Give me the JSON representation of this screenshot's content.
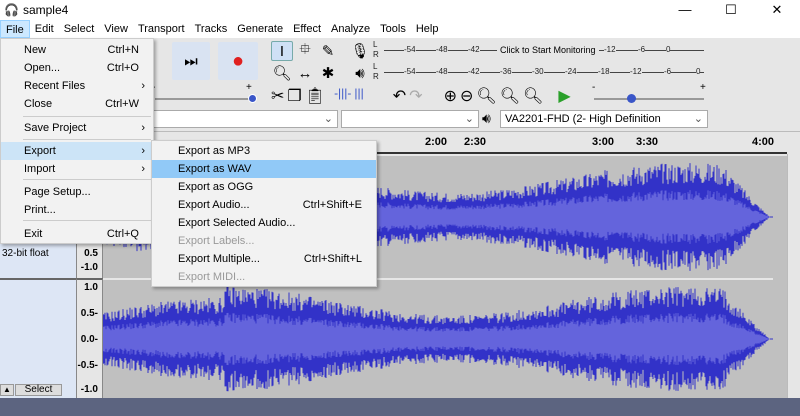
{
  "window": {
    "title": "sample4",
    "minimize": "—",
    "maximize": "☐",
    "close": "✕"
  },
  "menubar": [
    "File",
    "Edit",
    "Select",
    "View",
    "Transport",
    "Tracks",
    "Generate",
    "Effect",
    "Analyze",
    "Tools",
    "Help"
  ],
  "file_menu": [
    {
      "label": "New",
      "shortcut": "Ctrl+N"
    },
    {
      "label": "Open...",
      "shortcut": "Ctrl+O"
    },
    {
      "label": "Recent Files",
      "submenu": true
    },
    {
      "label": "Close",
      "shortcut": "Ctrl+W"
    },
    {
      "label": "Save Project",
      "submenu": true
    },
    {
      "label": "Export",
      "submenu": true,
      "active": true
    },
    {
      "label": "Import",
      "submenu": true
    },
    {
      "label": "Page Setup..."
    },
    {
      "label": "Print..."
    },
    {
      "label": "Exit",
      "shortcut": "Ctrl+Q"
    }
  ],
  "export_menu": [
    {
      "label": "Export as MP3"
    },
    {
      "label": "Export as WAV",
      "highlighted": true
    },
    {
      "label": "Export as OGG"
    },
    {
      "label": "Export Audio...",
      "shortcut": "Ctrl+Shift+E"
    },
    {
      "label": "Export Selected Audio..."
    },
    {
      "label": "Export Labels...",
      "disabled": true
    },
    {
      "label": "Export Multiple...",
      "shortcut": "Ctrl+Shift+L"
    },
    {
      "label": "Export MIDI...",
      "disabled": true
    }
  ],
  "meters": {
    "record_ticks": [
      "-54",
      "-48",
      "-42",
      "-18",
      "-12",
      "-6",
      "0"
    ],
    "record_prompt": "Click to Start Monitoring",
    "play_ticks": [
      "-54",
      "-48",
      "-42",
      "-36",
      "-30",
      "-24",
      "-18",
      "-12",
      "-6",
      "0"
    ],
    "channels": [
      "L",
      "R"
    ]
  },
  "slider": {
    "minus": "-",
    "plus": "+"
  },
  "device": {
    "output": "VA2201-FHD (2- High Definition"
  },
  "ruler": [
    "2:00",
    "2:30",
    "3:00",
    "3:30",
    "4:00"
  ],
  "track": {
    "format": "32-bit float",
    "select": "Select",
    "scale_top": [
      "0.5",
      "-1.0"
    ],
    "scale": [
      "1.0",
      "0.5-",
      "0.0-",
      "-0.5-",
      "-1.0"
    ]
  },
  "colors": {
    "wave": "#3232c8",
    "wave_rms": "#6464dc",
    "highlight": "#91c9f7"
  }
}
